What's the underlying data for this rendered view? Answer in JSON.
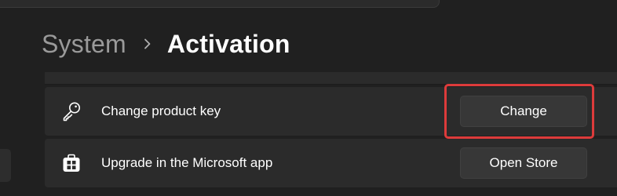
{
  "breadcrumb": {
    "parent": "System",
    "separator_icon": "chevron-right-icon",
    "current": "Activation"
  },
  "settings": [
    {
      "icon": "key-icon",
      "label": "Change product key",
      "button_label": "Change"
    },
    {
      "icon": "store-icon",
      "label": "Upgrade in the Microsoft app",
      "button_label": "Open Store"
    }
  ],
  "colors": {
    "background": "#202020",
    "card": "#2b2b2b",
    "button": "#373737",
    "highlight": "#dd3b3b",
    "breadcrumb_parent": "#9a9a9a"
  }
}
